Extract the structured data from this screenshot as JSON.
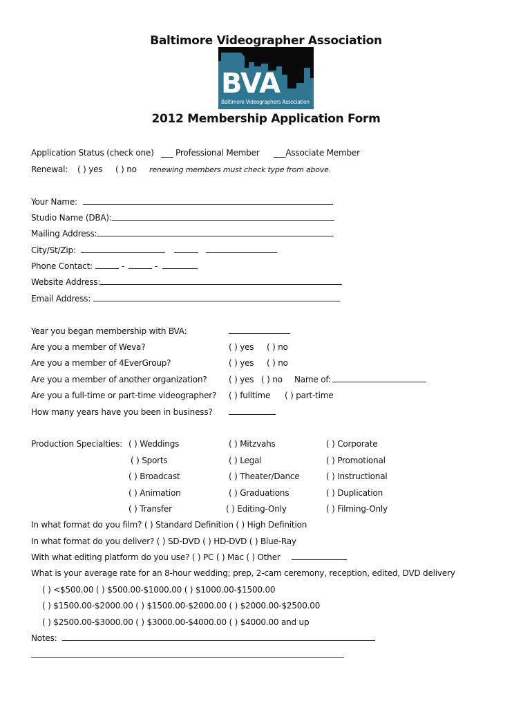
{
  "header": {
    "org_title": "Baltimore Videographer Association",
    "logo_text": "BVA",
    "logo_subtext": "Baltimore Videographers Association",
    "form_title": "2012 Membership Application Form",
    "colors": {
      "logo_blue": "#2e7591",
      "logo_sky": "#0a0a0a"
    }
  },
  "status": {
    "label": "Application Status (check one)",
    "professional": "___ Professional Member",
    "associate": "___Associate Member"
  },
  "renewal": {
    "label": "Renewal:",
    "yes": "(  ) yes",
    "no": "(  ) no",
    "note": "renewing members must check type from above."
  },
  "contact": {
    "name": "Your Name:",
    "studio": "Studio Name (DBA):",
    "mailing": "Mailing Address:",
    "city": "City/St/Zip:",
    "phone": "Phone Contact:",
    "phone_sep": "-",
    "website": "Website Address:",
    "email": "Email Address:"
  },
  "membership": {
    "year_label": "Year you began membership with BVA:",
    "weva_label": "Are you a member of Weva?",
    "weva_yes": "(  ) yes",
    "weva_no": "(  ) no",
    "forever_label": "Are you a member of 4EverGroup?",
    "forever_yes": "(  ) yes",
    "forever_no": "(  ) no",
    "other_label": "Are you a member of another organization?",
    "other_yes": "(  ) yes",
    "other_no": "(  ) no",
    "other_name": "Name of:",
    "fulltime_label": "Are you a full-time or part-time videographer?",
    "fulltime": "(  ) fulltime",
    "parttime": "(  ) part-time",
    "years_label": "How many years have you been in business?"
  },
  "specialties": {
    "label": "Production Specialties:",
    "col1": [
      "(  ) Weddings",
      "(  ) Sports",
      "(  ) Broadcast",
      "(  ) Animation",
      "(  ) Transfer"
    ],
    "col2": [
      "(  ) Mitzvahs",
      "(  ) Legal",
      "(  ) Theater/Dance",
      "(  ) Graduations",
      "(  ) Editing-Only"
    ],
    "col3": [
      "(  ) Corporate",
      "(  ) Promotional",
      "(  ) Instructional",
      "(  ) Duplication",
      "(  ) Filming-Only"
    ]
  },
  "formats": {
    "film": "In what format do you film?  (  ) Standard Definition  (  ) High Definition",
    "deliver": "In what format do you deliver?  (  ) SD-DVD    (  )  HD-DVD    (  ) Blue-Ray",
    "editing": "With what editing platform do you use? (  ) PC  (  )  Mac (  ) Other",
    "rate_question": "What is your average rate for an 8-hour wedding; prep, 2-cam ceremony, reception, edited, DVD delivery"
  },
  "rates": [
    "(  ) <$500.00     (  ) $500.00-$1000.00 (  ) $1000.00-$1500.00",
    "(  ) $1500.00-$2000.00 (  ) $1500.00-$2000.00 (  ) $2000.00-$2500.00",
    "(  ) $2500.00-$3000.00 (  ) $3000.00-$4000.00 (  ) $4000.00 and up"
  ],
  "notes": {
    "label": "Notes:"
  }
}
